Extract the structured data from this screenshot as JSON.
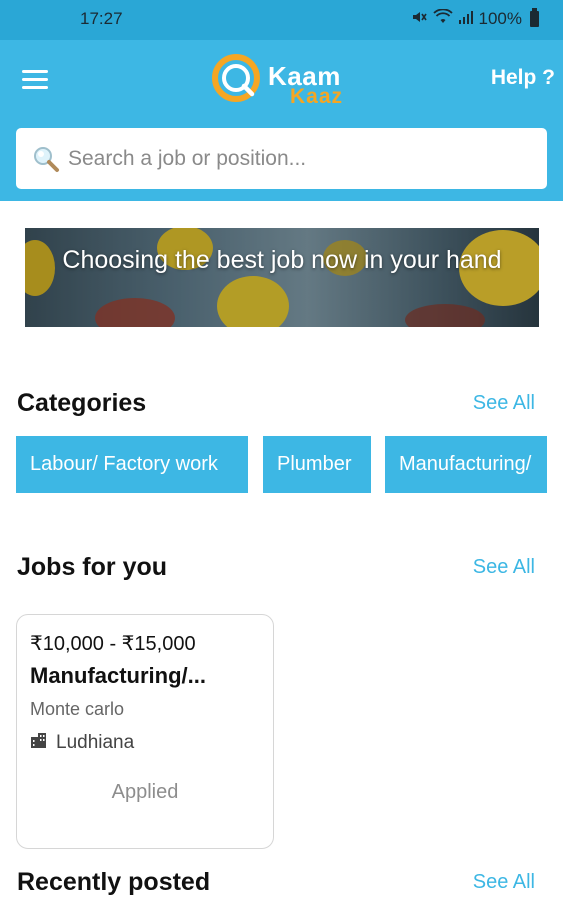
{
  "status_bar": {
    "time": "17:27",
    "battery": "100%"
  },
  "app": {
    "logo_primary": "Kaam",
    "logo_secondary": "Kaaz",
    "help": "Help ?"
  },
  "search": {
    "placeholder": "Search a job or position..."
  },
  "banner": {
    "text": "Choosing the best job now in your hand"
  },
  "categories": {
    "title": "Categories",
    "see_all": "See All",
    "items": [
      "Labour/ Factory work",
      "Plumber",
      "Manufacturing/"
    ]
  },
  "jobs_for_you": {
    "title": "Jobs for you",
    "see_all": "See All",
    "jobs": [
      {
        "salary": "₹10,000 - ₹15,000",
        "title": "Manufacturing/...",
        "company": "Monte carlo",
        "location": "Ludhiana",
        "status": "Applied"
      }
    ]
  },
  "recently_posted": {
    "title": "Recently posted",
    "see_all": "See All"
  },
  "colors": {
    "accent": "#3db7e4",
    "logo_orange": "#f5a623",
    "status_bar": "#2aa7d6"
  },
  "icons": [
    "menu-icon",
    "search-icon",
    "building-icon",
    "mute-icon",
    "wifi-icon",
    "signal-icon",
    "battery-icon"
  ]
}
